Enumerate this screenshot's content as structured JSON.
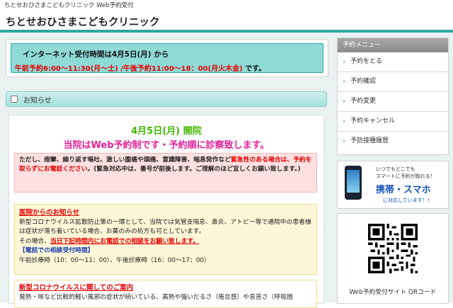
{
  "topbar": {
    "text": "ちとせおひさまこどもクリニック Web予約受付"
  },
  "header": {
    "title": "ちとせおひさまこどもクリニック"
  },
  "hours": {
    "line1": "インターネット受付時間は4月5日(月) から",
    "line2_red": "午前予約6:00～11:30(月～土) /午後予約11:00～18：00(月火木金)",
    "line2_end": " です。"
  },
  "news": {
    "label": "お知らせ"
  },
  "content": {
    "title1": "4月5日(月) 開院",
    "title2": "当院はWeb予約制です・予約順に診察致します。",
    "warning": {
      "part1": "ただし、痙攣、繰り返す嘔吐、激しい腹痛や頭痛、意識障害、喘息発作など",
      "part2_red": "緊急性のある場合は、予約を取らずにお電話ください",
      "part3": "。(緊急対応中は、番号が前後します。ご理解のほど宜しくお願い致します。)"
    },
    "notice": {
      "heading": "医院からのお知らせ",
      "body1": "新型コロナウイルス拡散防止策の一環として、当院では気管支喘息、鼻炎、アトピー等で通院中の患者様は症状が落ち着いている場合、お薬のみの処方も可としています。",
      "body2_pre": "その場合、",
      "body2_red": "当日下記時間内にお電話での相談をお願い致します。",
      "phone_head": "【電話での相談受付時間】",
      "phone_times": "午前診療時（10：00～11：00）、午後診療時（16：00～17：00）"
    },
    "corona": {
      "heading": "新型コロナウイルスに関してのご案内",
      "body": "発熱・咳など比較的軽い風邪の症状が続いている、高熱や強いだるさ（倦怠感）や息苦さ（呼吸困"
    }
  },
  "sidebar": {
    "menu_title": "予約メニュー",
    "items": [
      {
        "label": "予約をとる"
      },
      {
        "label": "予約確認"
      },
      {
        "label": "予約変更"
      },
      {
        "label": "予約キャンセル"
      },
      {
        "label": "予防接種履歴"
      }
    ],
    "mobile": {
      "line1": "いつでもどこでも",
      "line2": "スマートに予約が取れる！",
      "line3": "携帯・スマホ",
      "line4": "に対応しています！！"
    },
    "qr_caption": "Web予約受付サイト QRコード"
  },
  "colors": {
    "accent": "#2ea7a0",
    "alert_red": "#e40000",
    "green": "#3fb800",
    "magenta": "#e0229a"
  },
  "icons": {
    "menu_chevron": "chevron-right-icon",
    "news": "note-icon",
    "phone": "smartphone-icon"
  }
}
